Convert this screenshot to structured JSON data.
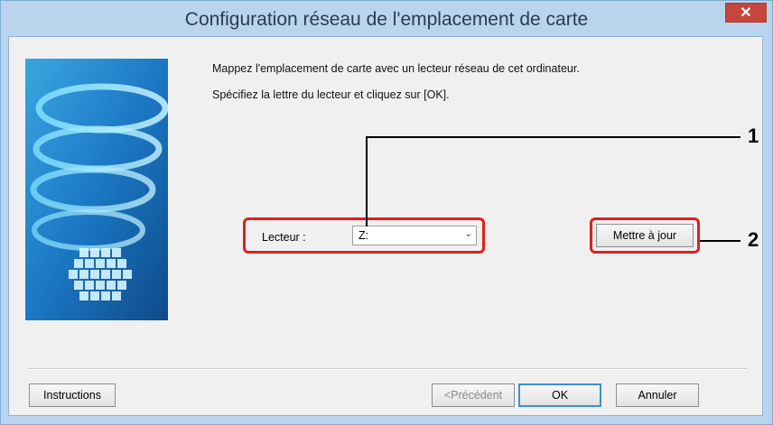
{
  "window": {
    "title": "Configuration réseau de l'emplacement de carte",
    "close_glyph": "✕"
  },
  "content": {
    "message_line1": "Mappez l'emplacement de carte avec un lecteur réseau de cet ordinateur.",
    "message_line2": "Spécifiez la lettre du lecteur et cliquez sur [OK].",
    "drive_label": "Lecteur :",
    "drive_value": "Z:",
    "drive_arrow": "⌄",
    "refresh_button": "Mettre à jour"
  },
  "footer": {
    "instructions_button": "Instructions",
    "back_button": "<Précédent",
    "ok_button": "OK",
    "cancel_button": "Annuler"
  },
  "callouts": [
    "1",
    "2"
  ],
  "colors": {
    "highlight": "#e0201b",
    "title_bar": "#b9d4ec",
    "close_button": "#c7463b"
  },
  "icons": {
    "close": "close-icon",
    "dropdown": "chevron-down-icon",
    "side_image": "spiral-artwork"
  }
}
